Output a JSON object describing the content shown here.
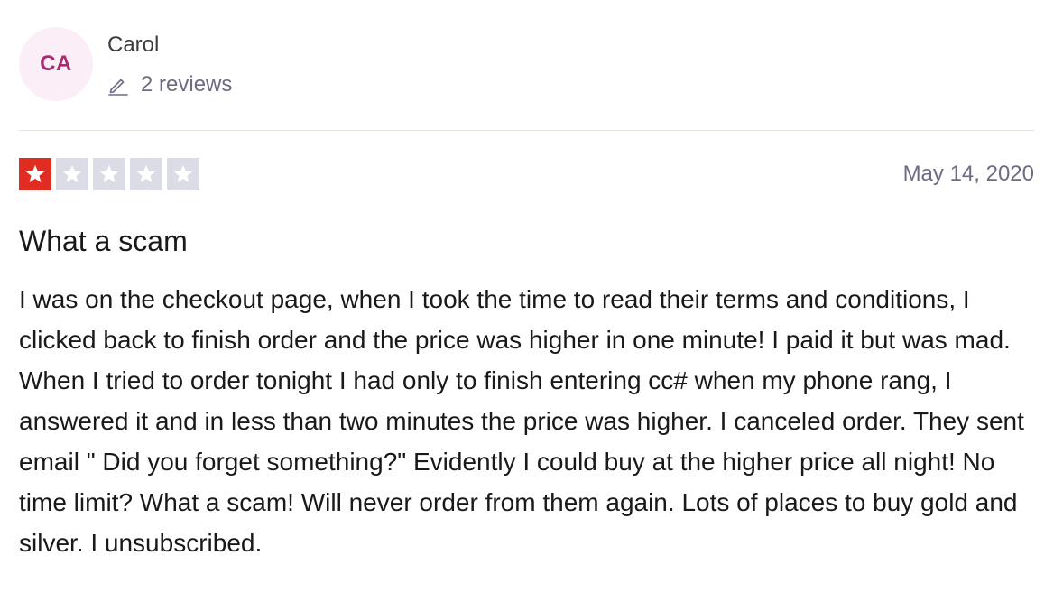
{
  "user": {
    "initials": "CA",
    "name": "Carol",
    "reviews_text": "2 reviews"
  },
  "review": {
    "rating": 1,
    "max_rating": 5,
    "date": "May 14, 2020",
    "title": "What a scam",
    "body": "I was on the checkout page, when I took the time to read their terms and conditions, I clicked back to finish order and the price was higher in one minute! I paid it but was mad. When I tried to order tonight I had only to finish entering cc# when my phone rang, I answered it and in less than two minutes the price was higher. I canceled order. They sent email \" Did you forget something?\" Evidently I could buy at the higher price all night! No time limit? What a scam! Will never order from them again. Lots of places to buy gold and silver. I unsubscribed."
  },
  "colors": {
    "avatar_bg": "#fbeef7",
    "avatar_text": "#a72c74",
    "star_filled": "#e12c22",
    "star_empty": "#dcdce6",
    "muted_text": "#6c6c85"
  },
  "icons": {
    "reviews": "pencil-icon",
    "rating": "star-icon"
  }
}
